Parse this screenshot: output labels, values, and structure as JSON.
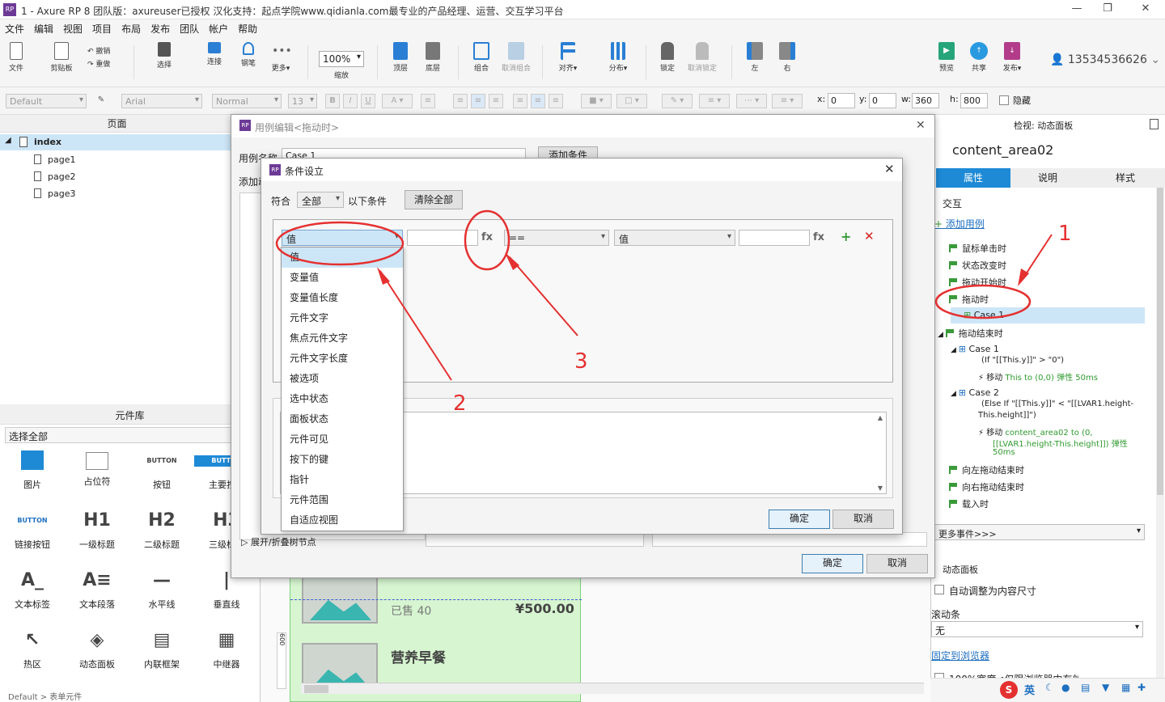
{
  "window": {
    "title": "1 - Axure RP 8 团队版：axureuser已授权 汉化支持：起点学院www.qidianla.com最专业的产品经理、运营、交互学习平台",
    "logo": "RP"
  },
  "menu": [
    "文件",
    "编辑",
    "视图",
    "项目",
    "布局",
    "发布",
    "团队",
    "帐户",
    "帮助"
  ],
  "toolbar": {
    "file": "文件",
    "clipboard": "剪贴板",
    "undo": "撤销",
    "redo": "重做",
    "select": "选择",
    "connect": "连接",
    "pen": "钢笔",
    "more": "更多▾",
    "zoom": "100%",
    "zoom_label": "缩放",
    "top": "顶层",
    "bottom": "底层",
    "group": "组合",
    "ungroup": "取消组合",
    "align": "对齐▾",
    "distribute": "分布▾",
    "lock": "锁定",
    "unlock": "取消锁定",
    "left": "左",
    "right": "右",
    "preview": "预览",
    "share": "共享",
    "publish": "发布▾",
    "user": "13534536626"
  },
  "format": {
    "style": "Default",
    "font": "Arial",
    "weight": "Normal",
    "size": "13",
    "x_label": "x:",
    "x": "0",
    "y_label": "y:",
    "y": "0",
    "w_label": "w:",
    "w": "360",
    "h_label": "h:",
    "h": "800",
    "hidden": "隐藏"
  },
  "pages": {
    "header": "页面",
    "root": "index",
    "children": [
      "page1",
      "page2",
      "page3"
    ]
  },
  "widgets": {
    "header": "元件库",
    "selector": "选择全部",
    "footer": "Default > 表单元件",
    "items": [
      {
        "icon": "",
        "label": "图片"
      },
      {
        "icon": "",
        "label": "占位符"
      },
      {
        "icon": "BUTTON",
        "label": "按钮"
      },
      {
        "icon": "BUTTON",
        "label": "主要按钮"
      },
      {
        "icon": "BUTTON",
        "label": "链接按钮"
      },
      {
        "icon": "H1",
        "label": "一级标题"
      },
      {
        "icon": "H2",
        "label": "二级标题"
      },
      {
        "icon": "H3",
        "label": "三级标题"
      },
      {
        "icon": "A_",
        "label": "文本标签"
      },
      {
        "icon": "A≡",
        "label": "文本段落"
      },
      {
        "icon": "—",
        "label": "水平线"
      },
      {
        "icon": "|",
        "label": "垂直线"
      },
      {
        "icon": "↖",
        "label": "热区"
      },
      {
        "icon": "◈",
        "label": "动态面板"
      },
      {
        "icon": "▤",
        "label": "内联框架"
      },
      {
        "icon": "▦",
        "label": "中继器"
      }
    ]
  },
  "canvas": {
    "item1_sold": "已售 40",
    "item1_price": "¥500.00",
    "item2_title": "营养早餐",
    "ruler": "600"
  },
  "inspector": {
    "header": "检视: 动态面板",
    "name": "content_area02",
    "tabs": [
      "属性",
      "说明",
      "样式"
    ],
    "interaction": "交互",
    "add_case": "添加用例",
    "events": [
      {
        "label": "鼠标单击时"
      },
      {
        "label": "状态改变时"
      },
      {
        "label": "拖动开始时"
      },
      {
        "label": "拖动时"
      }
    ],
    "case1": "Case 1",
    "drag_end": "拖动结束时",
    "case_a": "Case 1",
    "case_a_cond": "(If \"[[This.y]]\" > \"0\")",
    "case_a_action": "移动",
    "case_a_detail": "This to (0,0) 弹性 50ms",
    "case_b": "Case 2",
    "case_b_cond1": "(Else If \"[[This.y]]\" < \"[[LVAR1.height-",
    "case_b_cond2": "This.height]]\")",
    "case_b_action": "移动",
    "case_b_detail1": "content_area02 to (0,",
    "case_b_detail2": "[[LVAR1.height-This.height]]) 弹性",
    "case_b_detail3": "50ms",
    "events2": [
      "向左拖动结束时",
      "向右拖动结束时",
      "载入时"
    ],
    "more_events": "更多事件>>>",
    "panel_section": "动态面板",
    "auto_fit": "自动调整为内容尺寸",
    "scroll_label": "滚动条",
    "scroll_value": "无",
    "fix": "固定到浏览器",
    "full_width": "100%宽度<仅限浏览器中有效>"
  },
  "dialog_case": {
    "title": "用例编辑<拖动时>",
    "name_label": "用例名称",
    "name_value": "Case 1",
    "add_condition": "添加条件",
    "add_action": "添加动作",
    "expand": "展开/折叠树节点",
    "ok": "确定",
    "cancel": "取消"
  },
  "dialog_cond": {
    "title": "条件设立",
    "match_label": "符合",
    "match_value": "全部",
    "match_suffix": "以下条件",
    "clear": "清除全部",
    "col1": "值",
    "fx1": "fx",
    "op": "==",
    "col2": "值",
    "fx2": "fx",
    "ok": "确定",
    "cancel": "取消"
  },
  "dropdown": [
    "值",
    "变量值",
    "变量值长度",
    "元件文字",
    "焦点元件文字",
    "元件文字长度",
    "被选项",
    "选中状态",
    "面板状态",
    "元件可见",
    "按下的键",
    "指针",
    "元件范围",
    "自适应视图"
  ],
  "annotations": [
    "1",
    "2",
    "3"
  ],
  "taskbar": {
    "ime": "英"
  }
}
